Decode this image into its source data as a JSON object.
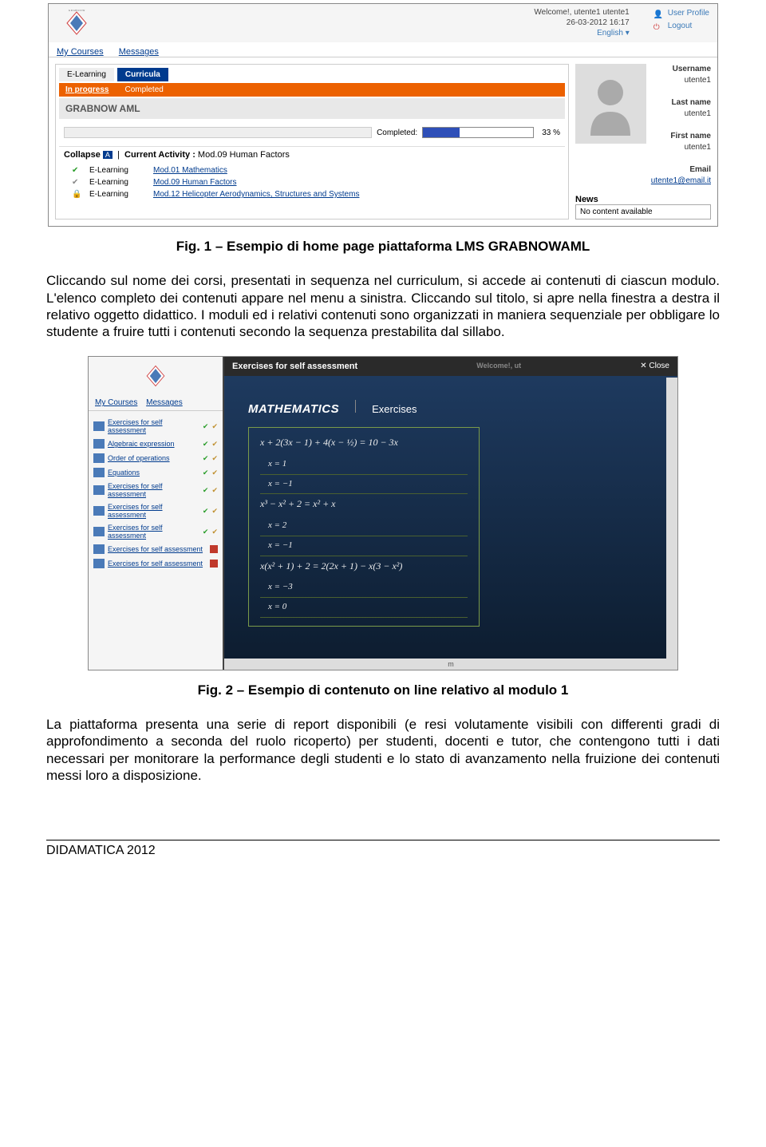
{
  "lms": {
    "welcome": "Welcome!, utente1 utente1",
    "date": "26-03-2012 16:17",
    "lang": "English",
    "userProfile": "User Profile",
    "logout": "Logout",
    "nav": {
      "courses": "My Courses",
      "messages": "Messages"
    },
    "tabs": {
      "elearning": "E-Learning",
      "curricula": "Curricula"
    },
    "subtabs": {
      "inprogress": "In progress",
      "completed": "Completed"
    },
    "courseTitle": "GRABNOW AML",
    "completedLabel": "Completed:",
    "progressPct": "33 %",
    "progressVal": 33,
    "collapse": "Collapse",
    "collapseIcon": "A",
    "currentActivityLabel": "Current Activity :",
    "currentActivity": "Mod.09 Human Factors",
    "modules": [
      {
        "icon": "check-green",
        "type": "E-Learning",
        "name": "Mod.01 Mathematics"
      },
      {
        "icon": "check-gray",
        "type": "E-Learning",
        "name": "Mod.09 Human Factors"
      },
      {
        "icon": "lock",
        "type": "E-Learning",
        "name": "Mod.12 Helicopter Aerodynamics, Structures and Systems"
      }
    ],
    "side": {
      "usernameLabel": "Username",
      "username": "utente1",
      "lastnameLabel": "Last name",
      "lastname": "utente1",
      "firstnameLabel": "First name",
      "firstname": "utente1",
      "emailLabel": "Email",
      "email": "utente1@email.it",
      "newsLabel": "News",
      "newsContent": "No content available"
    }
  },
  "caption1": "Fig. 1 – Esempio di home page piattaforma LMS GRABNOWAML",
  "para1": "Cliccando sul nome dei corsi, presentati in sequenza nel curriculum, si accede ai contenuti di ciascun modulo. L'elenco completo dei contenuti appare nel menu a sinistra. Cliccando sul titolo, si apre nella finestra a destra il relativo oggetto didattico. I moduli ed i relativi contenuti sono organizzati in maniera sequenziale per obbligare lo studente a fruire tutti i contenuti secondo la sequenza prestabilita dal sillabo.",
  "content": {
    "modalTitle": "Exercises for self assessment",
    "closeLabel": "✕ Close",
    "welcomeRight": "Welcome!, ut",
    "nav": {
      "courses": "My Courses",
      "messages": "Messages"
    },
    "leftItems": [
      {
        "txt": "Exercises for self assessment",
        "marks": [
          "green",
          "yellow"
        ]
      },
      {
        "txt": "Algebraic expression",
        "marks": [
          "green",
          "yellow"
        ]
      },
      {
        "txt": "Order of operations",
        "marks": [
          "green",
          "yellow"
        ]
      },
      {
        "txt": "Equations",
        "marks": [
          "green",
          "yellow"
        ]
      },
      {
        "txt": "Exercises for self assessment",
        "marks": [
          "green",
          "yellow"
        ]
      },
      {
        "txt": "Exercises for self assessment",
        "marks": [
          "green",
          "yellow"
        ]
      },
      {
        "txt": "Exercises for self assessment",
        "marks": [
          "green",
          "yellow"
        ]
      },
      {
        "txt": "Exercises for self assessment",
        "marks": [
          "stop"
        ]
      },
      {
        "txt": "Exercises for self assessment",
        "marks": [
          "stop"
        ]
      }
    ],
    "mathTitle": "MATHEMATICS",
    "mathSub": "Exercises",
    "questions": [
      {
        "q": "x + 2(3x − 1) + 4(x − ½) = 10 − 3x",
        "answers": [
          "x = 1",
          "x = −1"
        ]
      },
      {
        "q": "x³ − x² + 2 = x² + x",
        "answers": [
          "x = 2",
          "x = −1"
        ]
      },
      {
        "q": "x(x² + 1) + 2 = 2(2x + 1) − x(3 − x²)",
        "answers": [
          "x = −3",
          "x = 0"
        ]
      }
    ],
    "scrollMid": "m"
  },
  "caption2": "Fig. 2 – Esempio di contenuto on line relativo al modulo 1",
  "para2": "La piattaforma presenta una serie di report disponibili (e resi volutamente visibili con differenti gradi di approfondimento a seconda del ruolo ricoperto) per studenti, docenti e tutor, che contengono tutti i dati necessari per monitorare la performance degli studenti e lo stato di avanzamento nella fruizione dei contenuti messi loro a disposizione.",
  "footer": "DIDAMATICA 2012"
}
